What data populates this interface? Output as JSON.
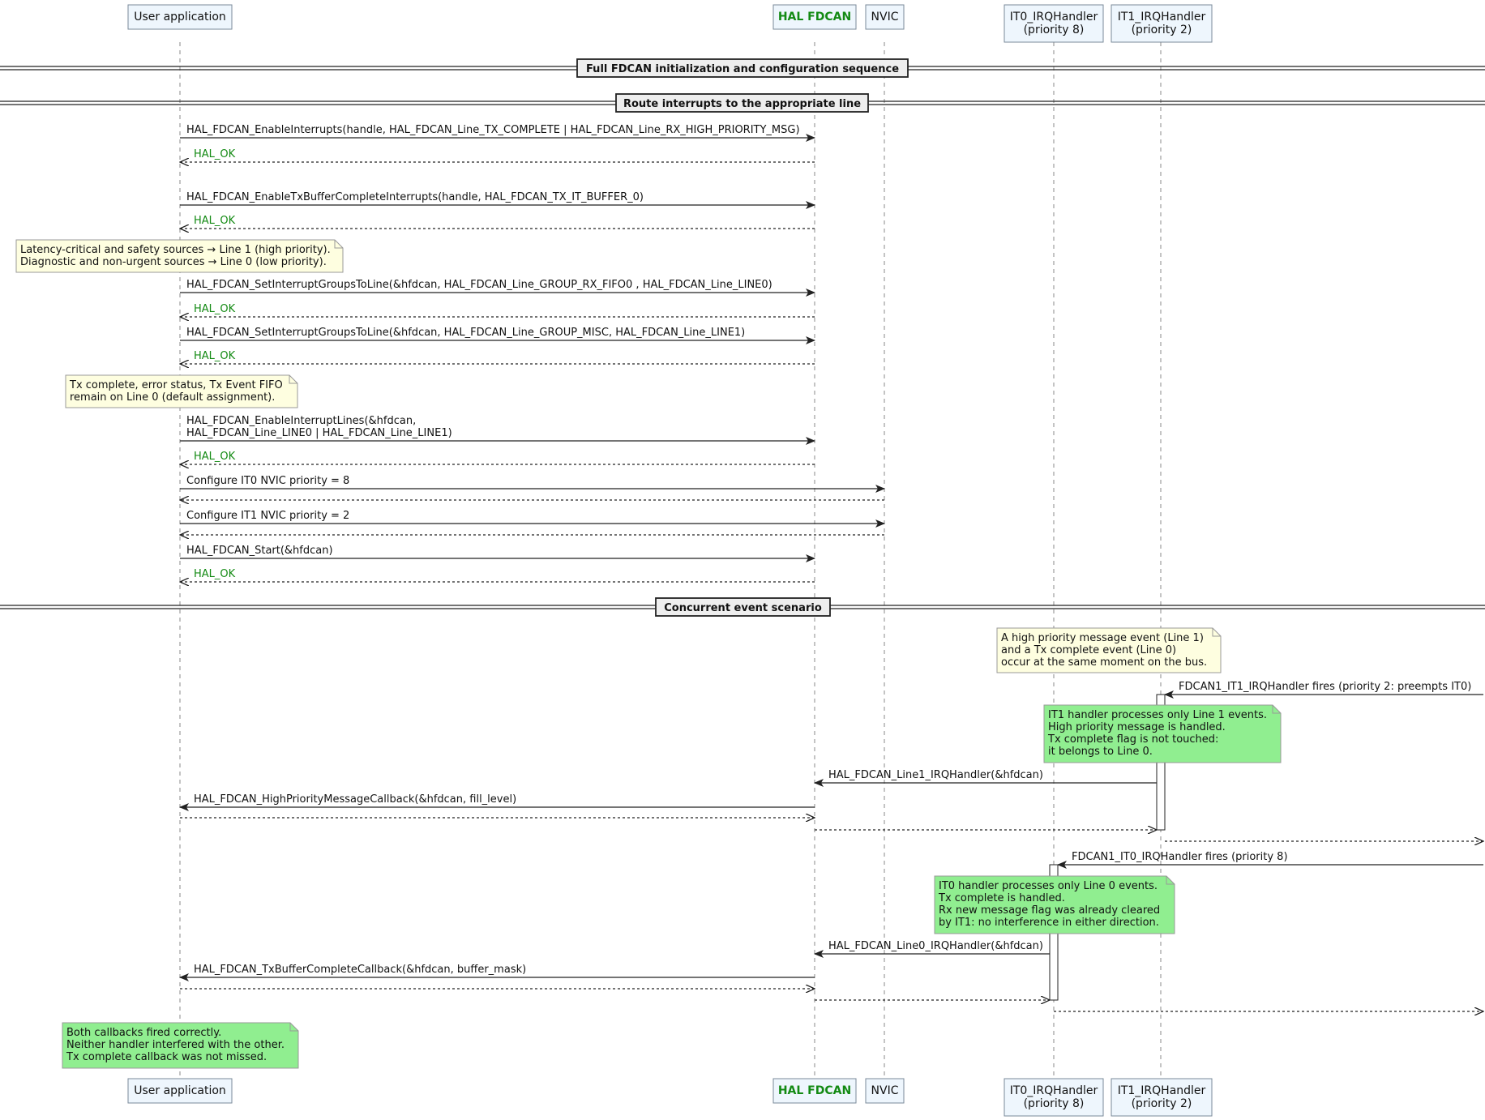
{
  "participants": [
    {
      "id": "user",
      "lines": [
        "User application"
      ],
      "bold": false
    },
    {
      "id": "hal",
      "lines": [
        "HAL FDCAN"
      ],
      "bold": true
    },
    {
      "id": "nvic",
      "lines": [
        "NVIC"
      ],
      "bold": false
    },
    {
      "id": "it0",
      "lines": [
        "IT0_IRQHandler",
        "(priority 8)"
      ],
      "bold": false
    },
    {
      "id": "it1",
      "lines": [
        "IT1_IRQHandler",
        "(priority 2)"
      ],
      "bold": false
    }
  ],
  "dividers": [
    "Full FDCAN initialization and configuration sequence",
    "Route interrupts to the appropriate line",
    "Concurrent event scenario"
  ],
  "messages": [
    [
      "HAL_FDCAN_EnableInterrupts(handle, HAL_FDCAN_Line_TX_COMPLETE | HAL_FDCAN_Line_RX_HIGH_PRIORITY_MSG)"
    ],
    [
      "HAL_OK"
    ],
    [
      "HAL_FDCAN_EnableTxBufferCompleteInterrupts(handle, HAL_FDCAN_TX_IT_BUFFER_0)"
    ],
    [
      "HAL_OK"
    ],
    [
      "HAL_FDCAN_SetInterruptGroupsToLine(&hfdcan,  HAL_FDCAN_Line_GROUP_RX_FIFO0 ,  HAL_FDCAN_Line_LINE0)"
    ],
    [
      "HAL_OK"
    ],
    [
      "HAL_FDCAN_SetInterruptGroupsToLine(&hfdcan, HAL_FDCAN_Line_GROUP_MISC,  HAL_FDCAN_Line_LINE1)"
    ],
    [
      "HAL_OK"
    ],
    [
      "HAL_FDCAN_EnableInterruptLines(&hfdcan,",
      "  HAL_FDCAN_Line_LINE0 | HAL_FDCAN_Line_LINE1)"
    ],
    [
      "HAL_OK"
    ],
    [
      "Configure IT0 NVIC priority = 8"
    ],
    [
      ""
    ],
    [
      "Configure IT1 NVIC priority = 2"
    ],
    [
      ""
    ],
    [
      "HAL_FDCAN_Start(&hfdcan)"
    ],
    [
      "HAL_OK"
    ],
    [
      "FDCAN1_IT1_IRQHandler fires (priority 2: preempts IT0)"
    ],
    [
      "HAL_FDCAN_Line1_IRQHandler(&hfdcan)"
    ],
    [
      "HAL_FDCAN_HighPriorityMessageCallback(&hfdcan, fill_level)"
    ],
    [
      ""
    ],
    [
      ""
    ],
    [
      ""
    ],
    [
      "FDCAN1_IT0_IRQHandler fires (priority 8)"
    ],
    [
      "HAL_FDCAN_Line0_IRQHandler(&hfdcan)"
    ],
    [
      "HAL_FDCAN_TxBufferCompleteCallback(&hfdcan, buffer_mask)"
    ],
    [
      ""
    ],
    [
      ""
    ],
    [
      ""
    ]
  ],
  "notes": [
    [
      "Latency-critical and safety sources → Line 1 (high priority).",
      "Diagnostic and non-urgent sources → Line 0 (low priority)."
    ],
    [
      "Tx complete, error status, Tx Event FIFO",
      "remain on Line 0 (default assignment)."
    ],
    [
      "A high priority message event (Line 1)",
      "and a Tx complete event (Line 0)",
      "occur at the same moment on the bus."
    ],
    [
      "IT1 handler processes only Line 1 events.",
      " High priority message is handled.",
      "Tx complete flag is not touched:",
      "it belongs to Line 0."
    ],
    [
      "IT0 handler processes only Line 0 events.",
      "Tx complete is handled.",
      "Rx new message flag was already cleared",
      "by IT1: no interference in either direction."
    ],
    [
      "Both callbacks fired correctly.",
      "Neither handler interfered with the other.",
      "Tx complete callback was not missed."
    ]
  ],
  "colors": {
    "lifeline": "#888888",
    "participant_fill": "#eef6fd",
    "participant_border": "#7a8a99",
    "hal_text": "#138a13",
    "return_ok": "#138a13",
    "note_yellow": "#fefee0",
    "note_green": "#90ee90",
    "note_border": "#999999",
    "divider_box": "#eeeeee"
  }
}
